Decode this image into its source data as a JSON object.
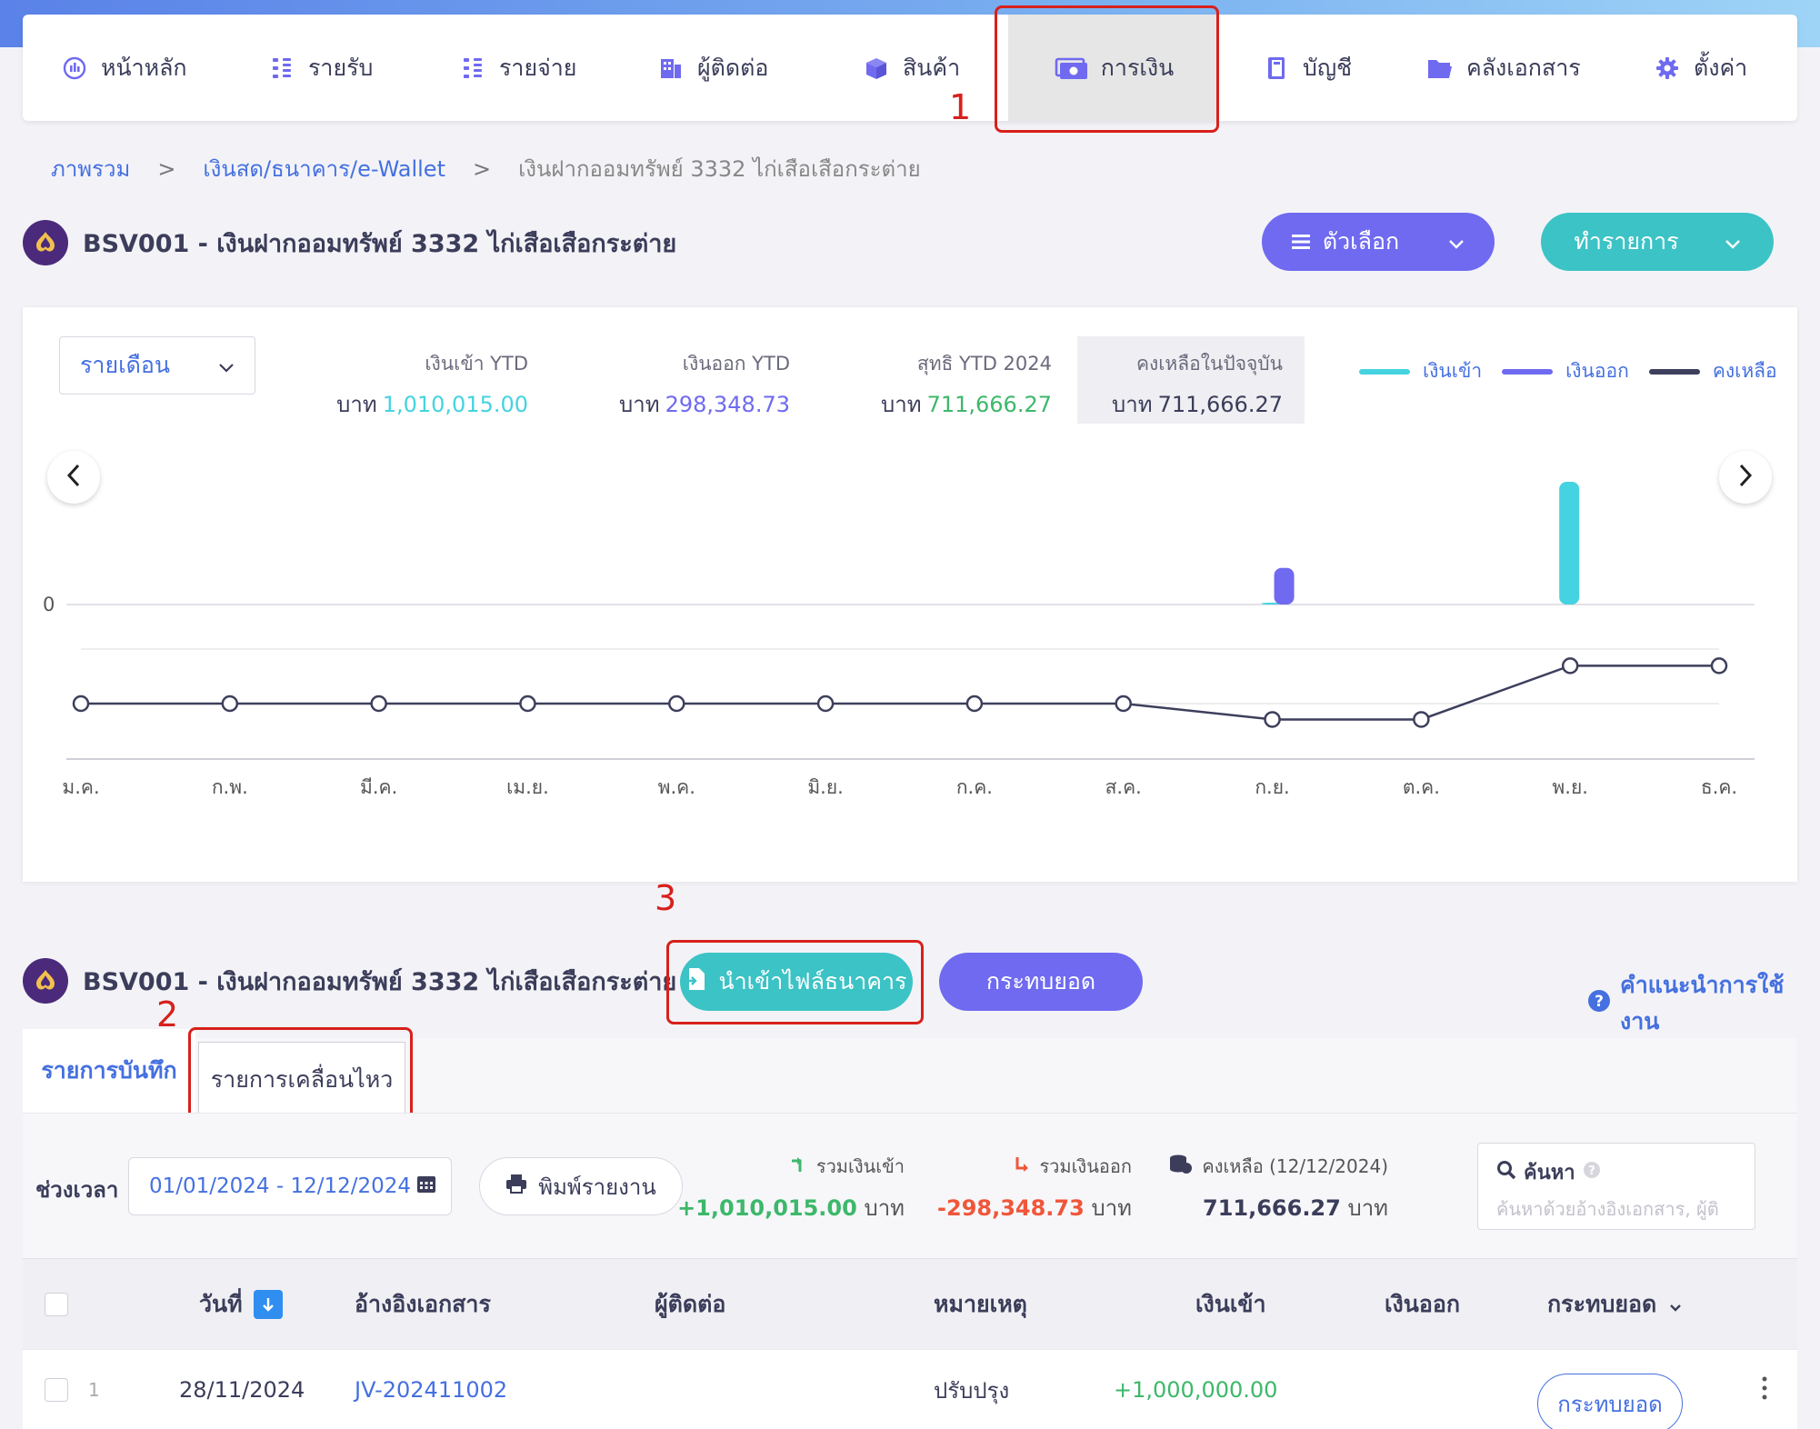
{
  "nav": {
    "items": [
      {
        "label": "หน้าหลัก",
        "icon": "dashboard-icon"
      },
      {
        "label": "รายรับ",
        "icon": "income-icon"
      },
      {
        "label": "รายจ่าย",
        "icon": "expense-icon"
      },
      {
        "label": "ผู้ติดต่อ",
        "icon": "contacts-icon"
      },
      {
        "label": "สินค้า",
        "icon": "product-box-icon"
      },
      {
        "label": "การเงิน",
        "icon": "money-icon",
        "active": true
      },
      {
        "label": "บัญชี",
        "icon": "ledger-book-icon"
      },
      {
        "label": "คลังเอกสาร",
        "icon": "folder-icon"
      },
      {
        "label": "ตั้งค่า",
        "icon": "gear-icon"
      }
    ]
  },
  "annotations": {
    "n1": "1",
    "n2": "2",
    "n3": "3"
  },
  "breadcrumb": {
    "overview": "ภาพรวม",
    "sep": ">",
    "cash": "เงินสด/ธนาคาร/e-Wallet",
    "current": "เงินฝากออมทรัพย์ 3332 ไก่เสือเสือกระต่าย"
  },
  "account": {
    "title": "BSV001 - เงินฝากออมทรัพย์ 3332 ไก่เสือเสือกระต่าย"
  },
  "buttons": {
    "options": "ตัวเลือก",
    "transact": "ทำรายการ",
    "import_bank": "นำเข้าไฟล์ธนาคาร",
    "reconcile": "กระทบยอด",
    "help": "คำแนะนำการใช้งาน",
    "print": "พิมพ์รายงาน"
  },
  "summary_card": {
    "period": "รายเดือน",
    "in_ytd_label": "เงินเข้า YTD",
    "in_ytd_currency": "บาท",
    "in_ytd_value": "1,010,015.00",
    "out_ytd_label": "เงินออก YTD",
    "out_ytd_currency": "บาท",
    "out_ytd_value": "298,348.73",
    "net_ytd_label": "สุทธิ YTD 2024",
    "net_ytd_currency": "บาท",
    "net_ytd_value": "711,666.27",
    "balance_label": "คงเหลือในปัจจุบัน",
    "balance_currency": "บาท",
    "balance_value": "711,666.27",
    "legend_in": "เงินเข้า",
    "legend_out": "เงินออก",
    "legend_balance": "คงเหลือ"
  },
  "colors": {
    "in": "#45d3e1",
    "out": "#6f6af0",
    "balance": "#3d3f5c",
    "positive": "#3db86a",
    "negative": "#f0563a",
    "link": "#4570e0"
  },
  "chart_data": {
    "type": "bar",
    "categories": [
      "ม.ค.",
      "ก.พ.",
      "มี.ค.",
      "เม.ย.",
      "พ.ค.",
      "มิ.ย.",
      "ก.ค.",
      "ส.ค.",
      "ก.ย.",
      "ต.ค.",
      "พ.ย.",
      "ธ.ค."
    ],
    "y_tick_labels": [
      "0"
    ],
    "series": [
      {
        "name": "เงินเข้า",
        "type": "bar",
        "values": [
          0,
          0,
          0,
          0,
          0,
          0,
          0,
          0,
          15,
          0,
          1000000,
          0
        ]
      },
      {
        "name": "เงินออก",
        "type": "bar",
        "values": [
          0,
          0,
          0,
          0,
          0,
          0,
          0,
          0,
          298348.73,
          0,
          0,
          0
        ]
      },
      {
        "name": "คงเหลือ",
        "type": "line",
        "values": [
          0,
          0,
          0,
          0,
          0,
          0,
          0,
          0,
          -298333.73,
          -298333.73,
          711666.27,
          711666.27
        ]
      }
    ],
    "grid": true,
    "legend": "top-right"
  },
  "tabs": {
    "records": "รายการบันทึก",
    "movements": "รายการเคลื่อนไหว"
  },
  "filter": {
    "period_label": "ช่วงเวลา",
    "date_range": "01/01/2024 - 12/12/2024",
    "total_in_label": "รวมเงินเข้า",
    "total_in_value": "+1,010,015.00",
    "total_out_label": "รวมเงินออก",
    "total_out_value": "-298,348.73",
    "balance_label": "คงเหลือ (12/12/2024)",
    "balance_value": "711,666.27",
    "currency": "บาท",
    "search_label": "ค้นหา",
    "search_placeholder": "ค้นหาด้วยอ้างอิงเอกสาร, ผู้ติ"
  },
  "table": {
    "headers": {
      "date": "วันที่",
      "doc_ref": "อ้างอิงเอกสาร",
      "contact": "ผู้ติดต่อ",
      "note": "หมายเหตุ",
      "in": "เงินเข้า",
      "out": "เงินออก",
      "reconcile": "กระทบยอด"
    },
    "rows": [
      {
        "index": "1",
        "date": "28/11/2024",
        "doc_ref": "JV-202411002",
        "contact": "",
        "note": "ปรับปรุง",
        "in": "+1,000,000.00",
        "out": "",
        "action": "กระทบยอด"
      }
    ]
  }
}
